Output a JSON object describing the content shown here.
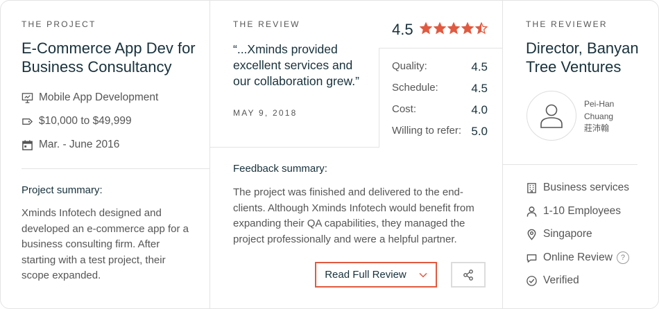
{
  "project": {
    "eyebrow": "THE PROJECT",
    "title_line1": "E-Commerce App Dev for",
    "title_line2": "Business Consultancy",
    "service": "Mobile App Development",
    "budget": "$10,000 to $49,999",
    "dates": "Mar. - June 2016",
    "summary_heading": "Project summary:",
    "summary_lines": [
      "Xminds Infotech designed and",
      "developed an e-commerce app for a",
      "business consulting firm. After",
      "starting with a test project, their",
      "scope expanded."
    ]
  },
  "review": {
    "eyebrow": "THE REVIEW",
    "quote_lines": [
      "“...Xminds provided",
      "excellent services and",
      "our collaboration grew.”"
    ],
    "date": "MAY 9, 2018",
    "overall": "4.5",
    "star_count": 4.5,
    "scores": [
      {
        "label": "Quality:",
        "value": "4.5"
      },
      {
        "label": "Schedule:",
        "value": "4.5"
      },
      {
        "label": "Cost:",
        "value": "4.0"
      },
      {
        "label": "Willing to refer:",
        "value": "5.0"
      }
    ],
    "feedback_heading": "Feedback summary:",
    "feedback_lines": [
      "The project was finished and delivered to the end-",
      "clients. Although Xminds Infotech would benefit from",
      "expanding their QA capabilities, they managed the",
      "project professionally and were a helpful partner."
    ],
    "read_button": "Read Full Review",
    "accent": "#e05a40",
    "star_color": "#e05a40"
  },
  "reviewer": {
    "eyebrow": "THE REVIEWER",
    "title_line1": "Director, Banyan",
    "title_line2": "Tree Ventures",
    "name_line1": "Pei-Han",
    "name_line2": "Chuang",
    "name_line3": "莊沛翰",
    "industry": "Business services",
    "size": "1-10 Employees",
    "location": "Singapore",
    "review_type": "Online Review",
    "help": "?",
    "verified": "Verified"
  }
}
